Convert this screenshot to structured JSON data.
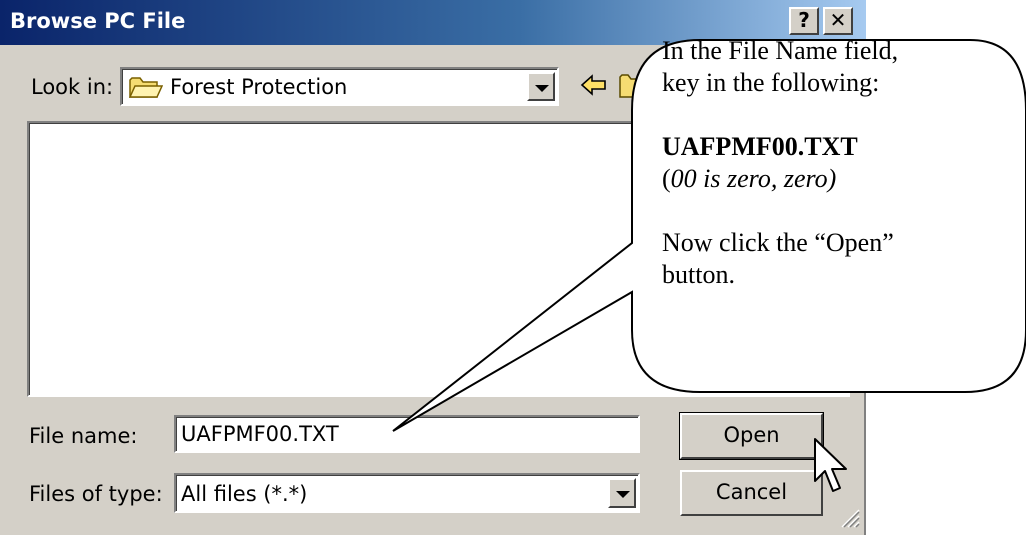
{
  "window": {
    "title": "Browse PC File",
    "help_label": "?",
    "close_label": "✕"
  },
  "look_in": {
    "label": "Look in:",
    "value": "Forest Protection",
    "icon": "folder-icon"
  },
  "toolbar": {
    "back_icon": "back-arrow-icon",
    "up_icon": "up-folder-icon"
  },
  "file_name": {
    "label": "File name:",
    "value": "UAFPMF00.TXT"
  },
  "file_type": {
    "label": "Files of type:",
    "value": "All files (*.*)"
  },
  "buttons": {
    "open": "Open",
    "cancel": "Cancel"
  },
  "callout": {
    "line1": "In the File Name field,",
    "line2": "key in the following:",
    "filename": "UAFPMF00.TXT",
    "note_open": "(",
    "note": "00 is zero, zero)",
    "line5": "Now click the “Open”",
    "line6": "button."
  },
  "colors": {
    "titlebar_start": "#0a246a",
    "titlebar_end": "#a6caf0",
    "face": "#d4d0c8"
  }
}
